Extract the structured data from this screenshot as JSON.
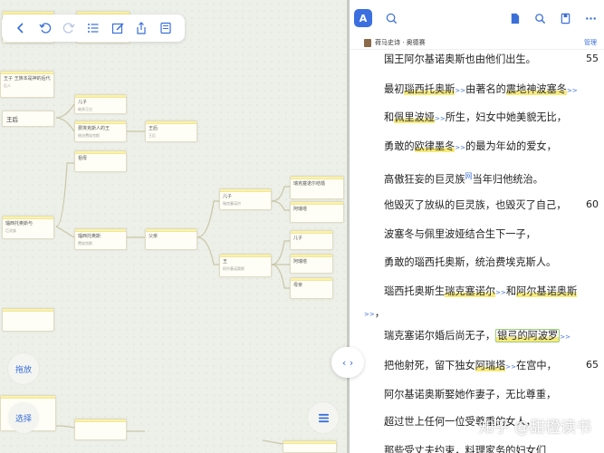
{
  "toolbar": {
    "buttons": [
      "back-icon",
      "undo-icon",
      "redo-icon",
      "list-icon",
      "edit-icon",
      "share-icon",
      "outline-icon"
    ]
  },
  "mindmap": {
    "nodes": [
      {
        "id": "n_top1",
        "t": "",
        "s": ""
      },
      {
        "id": "n_top2",
        "t": "",
        "s": ""
      },
      {
        "id": "n_a1",
        "t": "王子 王族本是神的后代",
        "s": "后人"
      },
      {
        "id": "n_a2",
        "t": "王后",
        "s": ""
      },
      {
        "id": "n_b1",
        "t": "儿子",
        "s": "继承王位"
      },
      {
        "id": "n_b2",
        "t": "费埃克斯人的王",
        "s": "统治费埃克斯"
      },
      {
        "id": "n_b3",
        "t": "王后",
        "s": "王后"
      },
      {
        "id": "n_c1",
        "t": "祖母",
        "s": ""
      },
      {
        "id": "n_c2",
        "t": "瑙西托奥斯",
        "s": "费埃克斯"
      },
      {
        "id": "n_c3",
        "t": "父亲",
        "s": ""
      },
      {
        "id": "n_root",
        "t": "瑙西托奥斯与",
        "s": "巨灵族"
      },
      {
        "id": "n_d1",
        "t": "儿子",
        "s": "瑞克塞诺尔"
      },
      {
        "id": "n_d2",
        "t": "王",
        "s": "阿尔基诺奥斯"
      },
      {
        "id": "n_e1",
        "t": "瑞克塞诺尔结婚",
        "s": ""
      },
      {
        "id": "n_e2",
        "t": "阿瑞塔",
        "s": ""
      },
      {
        "id": "n_e3",
        "t": "儿子",
        "s": ""
      },
      {
        "id": "n_e4",
        "t": "阿瑞塔",
        "s": ""
      },
      {
        "id": "n_e5",
        "t": "母亲",
        "s": ""
      },
      {
        "id": "n_lone",
        "t": "",
        "s": ""
      },
      {
        "id": "n_bot1",
        "t": "",
        "s": ""
      },
      {
        "id": "n_bot2",
        "t": "",
        "s": ""
      },
      {
        "id": "n_bot3",
        "t": "",
        "s": ""
      }
    ],
    "release_label": "拖放",
    "select_label": "选择"
  },
  "reader": {
    "book_title": "荷马史诗 · 奥德赛",
    "manage_label": "管理",
    "lines": [
      {
        "segs": [
          {
            "x": "国王阿尔基诺奥斯也由他们出生。"
          }
        ],
        "num": "55"
      },
      {
        "segs": [
          {
            "x": "最初"
          },
          {
            "h": "瑙西托奥斯"
          },
          {
            "a": ">>"
          },
          {
            "x": "由著名的"
          },
          {
            "h": "震地神波塞冬"
          },
          {
            "a": ">>"
          }
        ],
        "num": ""
      },
      {
        "segs": [
          {
            "x": "和"
          },
          {
            "h": "佩里波娅"
          },
          {
            "a": ">>"
          },
          {
            "x": "所生，妇女中她美貌无比，"
          }
        ],
        "num": ""
      },
      {
        "segs": [
          {
            "x": "勇敢的"
          },
          {
            "h": "欧律墨冬"
          },
          {
            "a": ">>"
          },
          {
            "x": "的最为年幼的爱女，"
          }
        ],
        "num": ""
      },
      {
        "segs": [
          {
            "x": "高傲狂妄的巨灵族"
          },
          {
            "n": "网"
          },
          {
            "x": "当年归他统治。"
          }
        ],
        "num": ""
      },
      {
        "segs": [
          {
            "x": "他毁灭了放纵的巨灵族，也毁灭了自己，"
          }
        ],
        "num": "60"
      },
      {
        "segs": [
          {
            "x": "波塞冬与佩里波娅结合生下一子，"
          }
        ],
        "num": ""
      },
      {
        "segs": [
          {
            "x": "勇敢的瑙西托奥斯，统治费埃克斯人。"
          }
        ],
        "num": ""
      },
      {
        "segs": [
          {
            "x": "瑙西托奥斯生"
          },
          {
            "h": "瑞克塞诺尔"
          },
          {
            "a": ">>"
          },
          {
            "x": "和"
          },
          {
            "h": "阿尔基诺奥斯"
          }
        ],
        "num": ""
      },
      {
        "segs": [
          {
            "a": ">>"
          },
          {
            "x": "，"
          }
        ],
        "num": ""
      },
      {
        "segs": [
          {
            "x": "瑞克塞诺尔婚后尚无子，"
          },
          {
            "b": "银弓的阿波罗"
          },
          {
            "a": ">>"
          }
        ],
        "num": ""
      },
      {
        "segs": [
          {
            "x": "把他射死，留下独女"
          },
          {
            "h": "阿瑞塔"
          },
          {
            "a": ">>"
          },
          {
            "x": "在宫中，"
          }
        ],
        "num": "65"
      },
      {
        "segs": [
          {
            "x": "阿尔基诺奥斯娶她作妻子，无比尊重，"
          }
        ],
        "num": ""
      },
      {
        "segs": [
          {
            "x": "超过世上任何一位受尊重的女人，"
          }
        ],
        "num": ""
      },
      {
        "segs": [
          {
            "x": "那些受丈夫约束，料理家务的妇女们"
          }
        ],
        "num": ""
      }
    ],
    "watermark": "知乎 @甜橙读书"
  },
  "split_handle_label": "‹ ›",
  "colors": {
    "accent": "#3a6fd8",
    "highlight": "#f7ea7a",
    "node_strip": "#fbf3a4"
  }
}
